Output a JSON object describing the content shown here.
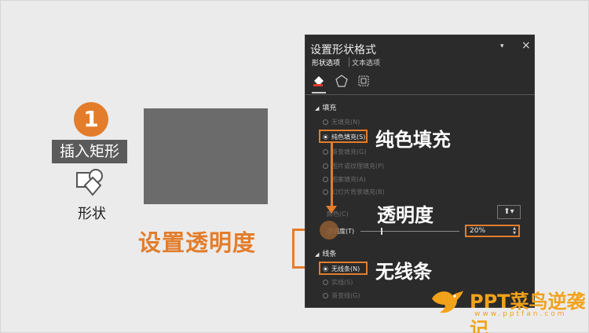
{
  "tutorial": {
    "step_number": "1",
    "insert_label": "插入矩形",
    "shapes_label": "形状",
    "set_transparency": "设置透明度"
  },
  "panel": {
    "title": "设置形状格式",
    "dropdown_glyph": "▾",
    "close_glyph": "×",
    "tabs": [
      "形状选项",
      "文本选项"
    ],
    "icons": [
      "fill-bucket-icon",
      "pentagon-icon",
      "size-properties-icon"
    ],
    "fill": {
      "header": "填充",
      "options": [
        "无填充(N)",
        "纯色填充(S)",
        "渐变填充(G)",
        "图片或纹理填充(P)",
        "图案填充(A)",
        "幻灯片背景填充(B)"
      ],
      "selected": "纯色填充(S)",
      "color_label": "颜色(C)",
      "transparency_label": "透明度(T)",
      "transparency_value": "20%",
      "transparency_fraction": 0.2
    },
    "line": {
      "header": "线条",
      "options": [
        "无线条(N)",
        "实线(S)",
        "渐变线(G)"
      ],
      "selected": "无线条(N)"
    }
  },
  "annotations": {
    "solid_fill": "纯色填充",
    "transparency": "透明度",
    "no_line": "无线条"
  },
  "logo": {
    "text": "PPT菜鸟逆袭记",
    "url": "www.pptfan.com"
  },
  "colors": {
    "accent": "#e37d2b",
    "panel_bg": "#2b2b2b",
    "page_bg": "#ebebeb",
    "logo": "#f2a21a"
  }
}
